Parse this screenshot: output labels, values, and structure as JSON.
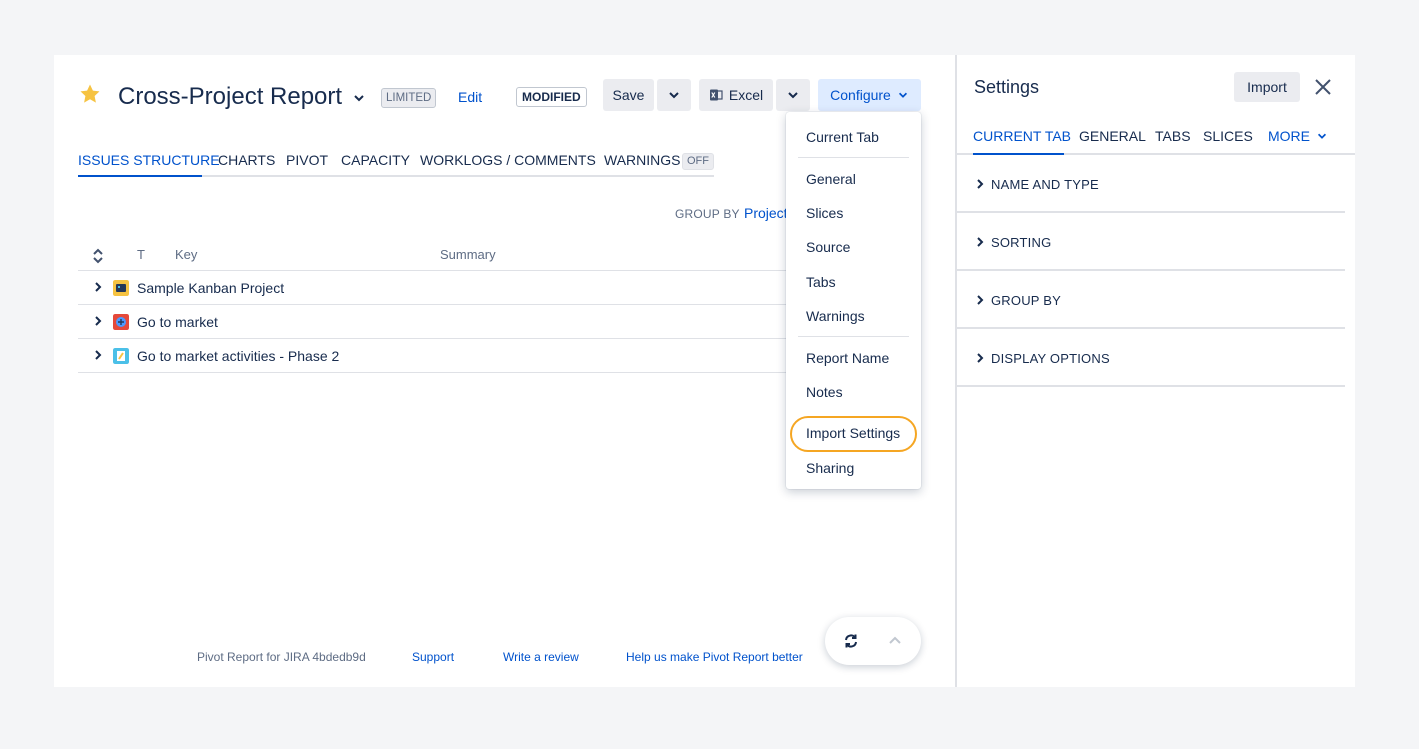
{
  "report": {
    "title": "Cross-Project Report",
    "limited_badge": "LIMITED",
    "edit_label": "Edit",
    "modified_badge": "MODIFIED"
  },
  "toolbar": {
    "save_label": "Save",
    "excel_label": "Excel",
    "configure_label": "Configure"
  },
  "tabs": [
    {
      "label": "ISSUES STRUCTURE",
      "active": true
    },
    {
      "label": "CHARTS"
    },
    {
      "label": "PIVOT"
    },
    {
      "label": "CAPACITY"
    },
    {
      "label": "WORKLOGS / COMMENTS"
    },
    {
      "label": "WARNINGS"
    }
  ],
  "warnings_badge": "OFF",
  "group_by": {
    "label": "GROUP BY",
    "value": "Project"
  },
  "table": {
    "columns": [
      "T",
      "Key",
      "Summary"
    ],
    "rows": [
      {
        "name": "Sample Kanban Project",
        "icon": "kanban-project-icon",
        "color": "#f6c342"
      },
      {
        "name": "Go to market",
        "icon": "go-to-market-icon",
        "color": "#e5493a"
      },
      {
        "name": "Go to market activities - Phase 2",
        "icon": "activities-project-icon",
        "color": "#4bc0e8"
      }
    ]
  },
  "configure_menu": {
    "items": [
      "Current Tab",
      "General",
      "Slices",
      "Source",
      "Tabs",
      "Warnings",
      "Report Name",
      "Notes",
      "Import Settings",
      "Sharing"
    ],
    "highlighted": "Import Settings"
  },
  "footer": {
    "version": "Pivot Report for JIRA 4bdedb9d",
    "support": "Support",
    "review": "Write a review",
    "help": "Help us make Pivot Report better"
  },
  "settings": {
    "title": "Settings",
    "import_label": "Import",
    "tabs": [
      "CURRENT TAB",
      "GENERAL",
      "TABS",
      "SLICES"
    ],
    "more_label": "MORE",
    "sections": [
      "NAME AND TYPE",
      "SORTING",
      "GROUP BY",
      "DISPLAY OPTIONS"
    ]
  },
  "colors": {
    "accent": "#0052cc",
    "star": "#f6c342",
    "highlight": "#f5a623"
  }
}
